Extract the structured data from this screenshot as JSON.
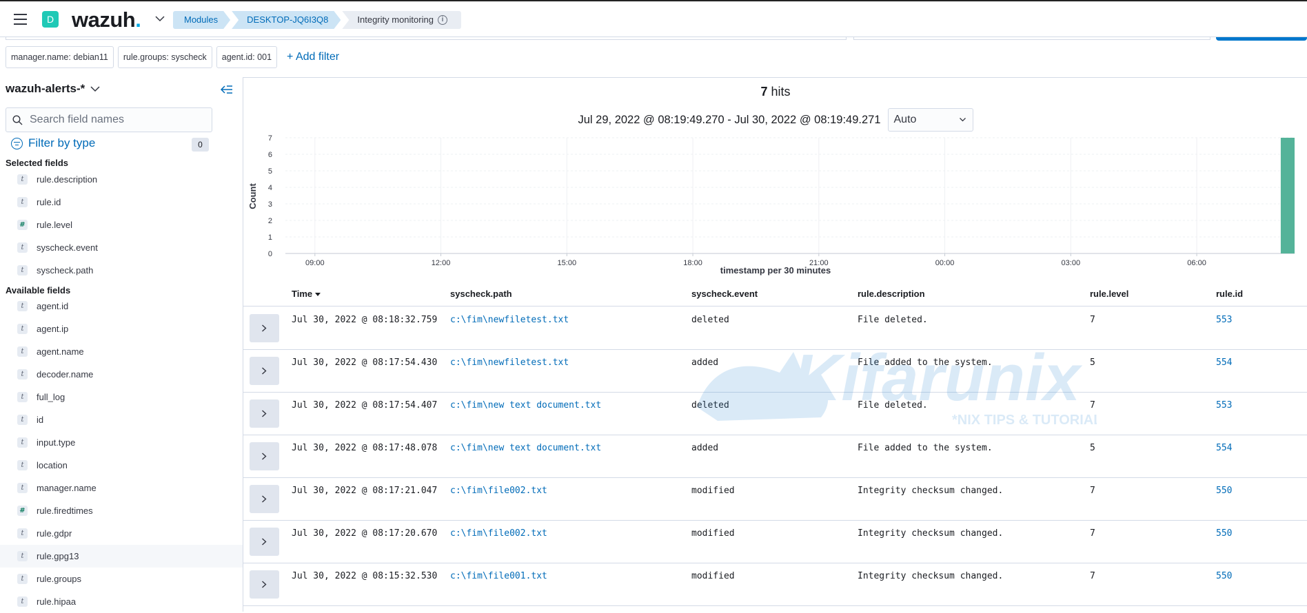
{
  "header": {
    "space_initial": "D",
    "logo_text": "wazuh",
    "logo_dot": ".",
    "breadcrumbs": [
      "Modules",
      "DESKTOP-JQ6I3Q8",
      "Integrity monitoring"
    ],
    "info_glyph": "i"
  },
  "filters": {
    "pills": [
      "manager.name: debian11",
      "rule.groups: syscheck",
      "agent.id: 001"
    ],
    "add_label": "+ Add filter"
  },
  "sidebar": {
    "index_pattern": "wazuh-alerts-*",
    "search_placeholder": "Search field names",
    "filter_by_type": "Filter by type",
    "filter_count": "0",
    "selected_heading": "Selected fields",
    "available_heading": "Available fields",
    "selected_fields": [
      {
        "type": "t",
        "name": "rule.description"
      },
      {
        "type": "t",
        "name": "rule.id"
      },
      {
        "type": "#",
        "name": "rule.level"
      },
      {
        "type": "t",
        "name": "syscheck.event"
      },
      {
        "type": "t",
        "name": "syscheck.path"
      }
    ],
    "available_fields": [
      {
        "type": "t",
        "name": "agent.id"
      },
      {
        "type": "t",
        "name": "agent.ip"
      },
      {
        "type": "t",
        "name": "agent.name"
      },
      {
        "type": "t",
        "name": "decoder.name"
      },
      {
        "type": "t",
        "name": "full_log"
      },
      {
        "type": "t",
        "name": "id"
      },
      {
        "type": "t",
        "name": "input.type"
      },
      {
        "type": "t",
        "name": "location"
      },
      {
        "type": "t",
        "name": "manager.name"
      },
      {
        "type": "#",
        "name": "rule.firedtimes"
      },
      {
        "type": "t",
        "name": "rule.gdpr"
      },
      {
        "type": "t",
        "name": "rule.gpg13"
      },
      {
        "type": "t",
        "name": "rule.groups"
      },
      {
        "type": "t",
        "name": "rule.hipaa"
      }
    ]
  },
  "main": {
    "hits_count": "7",
    "hits_label": "hits",
    "time_range": "Jul 29, 2022 @ 08:19:49.270 - Jul 30, 2022 @ 08:19:49.271",
    "interval": "Auto"
  },
  "chart_data": {
    "type": "bar",
    "title": "",
    "xlabel": "timestamp per 30 minutes",
    "ylabel": "Count",
    "ylim": [
      0,
      7
    ],
    "yticks": [
      0,
      1,
      2,
      3,
      4,
      5,
      6,
      7
    ],
    "xticks": [
      "09:00",
      "12:00",
      "15:00",
      "18:00",
      "21:00",
      "00:00",
      "03:00",
      "06:00"
    ],
    "bars": [
      {
        "x": "08:00",
        "value": 7
      }
    ],
    "bar_color": "#54b399",
    "grid": true
  },
  "table": {
    "columns": [
      "Time",
      "syscheck.path",
      "syscheck.event",
      "rule.description",
      "rule.level",
      "rule.id"
    ],
    "rows": [
      [
        "Jul 30, 2022 @ 08:18:32.759",
        "c:\\fim\\newfiletest.txt",
        "deleted",
        "File deleted.",
        "7",
        "553"
      ],
      [
        "Jul 30, 2022 @ 08:17:54.430",
        "c:\\fim\\newfiletest.txt",
        "added",
        "File added to the system.",
        "5",
        "554"
      ],
      [
        "Jul 30, 2022 @ 08:17:54.407",
        "c:\\fim\\new text document.txt",
        "deleted",
        "File deleted.",
        "7",
        "553"
      ],
      [
        "Jul 30, 2022 @ 08:17:48.078",
        "c:\\fim\\new text document.txt",
        "added",
        "File added to the system.",
        "5",
        "554"
      ],
      [
        "Jul 30, 2022 @ 08:17:21.047",
        "c:\\fim\\file002.txt",
        "modified",
        "Integrity checksum changed.",
        "7",
        "550"
      ],
      [
        "Jul 30, 2022 @ 08:17:20.670",
        "c:\\fim\\file002.txt",
        "modified",
        "Integrity checksum changed.",
        "7",
        "550"
      ],
      [
        "Jul 30, 2022 @ 08:15:32.530",
        "c:\\fim\\file001.txt",
        "modified",
        "Integrity checksum changed.",
        "7",
        "550"
      ]
    ]
  },
  "watermark": {
    "brand": "Kifarunix",
    "tagline": "*NIX TIPS & TUTORIALS"
  }
}
